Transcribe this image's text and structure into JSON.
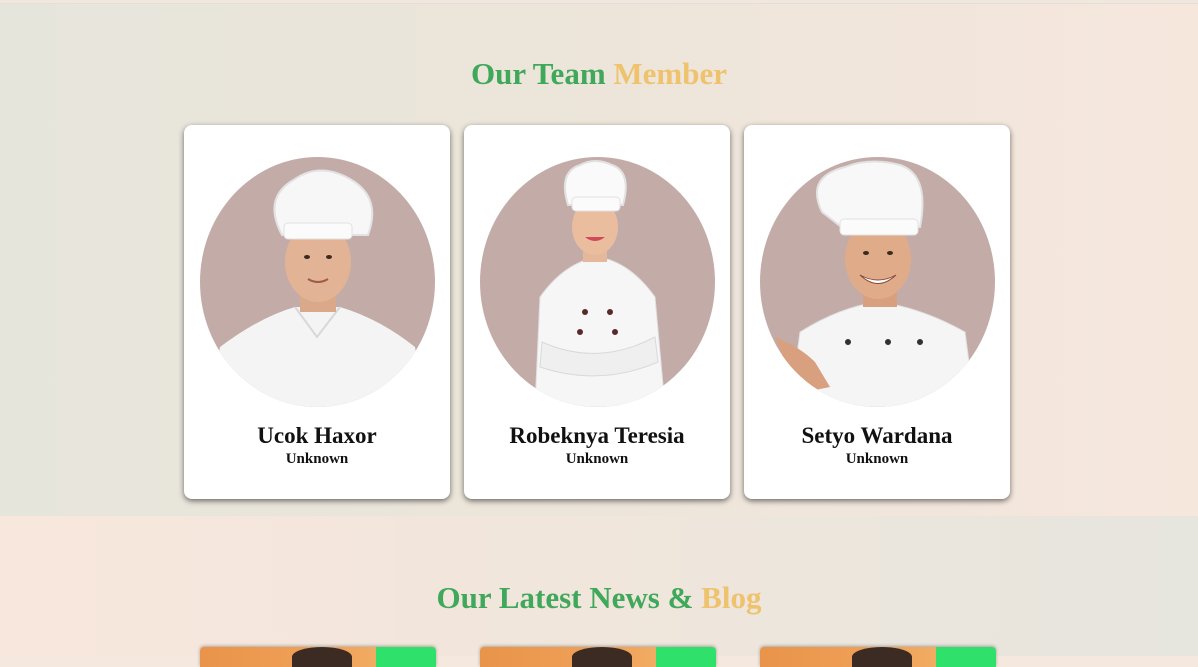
{
  "team": {
    "title_part1": "Our Team",
    "title_part2": "Member",
    "members": [
      {
        "name": "Ucok Haxor",
        "role": "Unknown"
      },
      {
        "name": "Robeknya Teresia",
        "role": "Unknown"
      },
      {
        "name": "Setyo Wardana",
        "role": "Unknown"
      }
    ]
  },
  "news": {
    "title_part1": "Our Latest News &",
    "title_part2": "Blog"
  },
  "colors": {
    "accent_green": "#3fa85b",
    "accent_gold": "#efc26d",
    "photo_bg": "#c3aca8"
  }
}
